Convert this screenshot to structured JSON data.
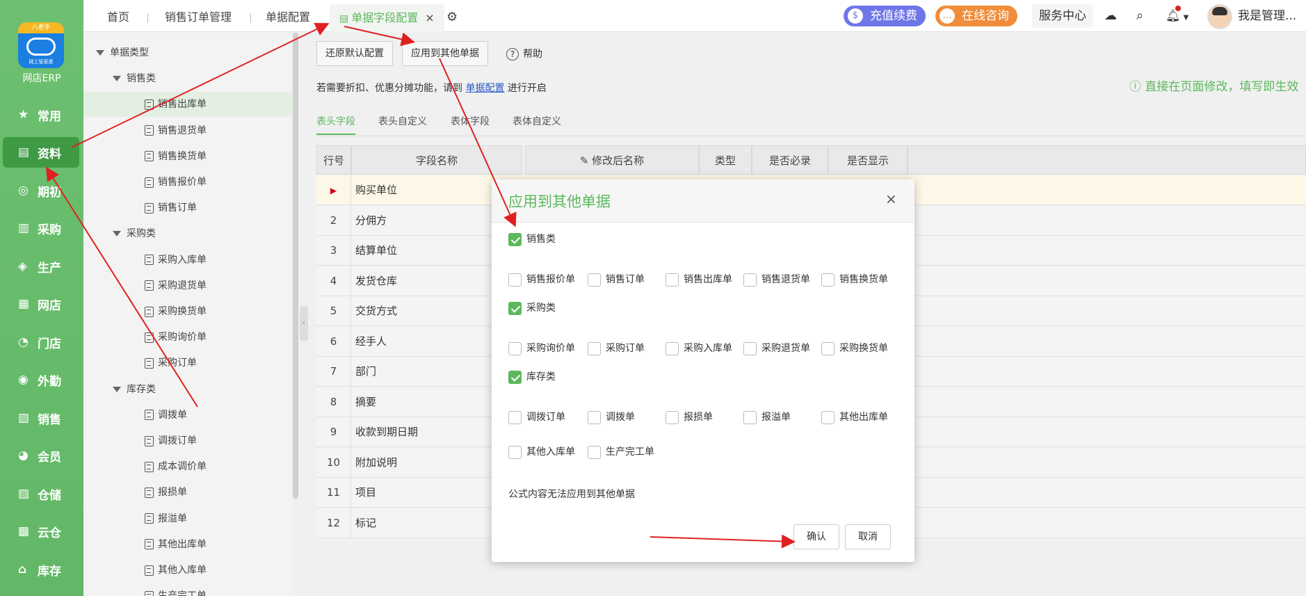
{
  "logo": {
    "band": "八老手",
    "sub": "网上管家婆",
    "name": "网店ERP"
  },
  "nav": [
    {
      "icon": "star-icon",
      "glyph": "★",
      "label": "常用"
    },
    {
      "icon": "document-icon",
      "glyph": "▤",
      "label": "资料"
    },
    {
      "icon": "target-icon",
      "glyph": "◎",
      "label": "期初"
    },
    {
      "icon": "purchase-icon",
      "glyph": "▥",
      "label": "采购"
    },
    {
      "icon": "production-icon",
      "glyph": "◈",
      "label": "生产"
    },
    {
      "icon": "shop-icon",
      "glyph": "▦",
      "label": "网店"
    },
    {
      "icon": "pie-icon",
      "glyph": "◔",
      "label": "门店"
    },
    {
      "icon": "field-icon",
      "glyph": "◉",
      "label": "外勤"
    },
    {
      "icon": "bar-chart-icon",
      "glyph": "▧",
      "label": "销售"
    },
    {
      "icon": "member-icon",
      "glyph": "◕",
      "label": "会员"
    },
    {
      "icon": "storage-icon",
      "glyph": "▨",
      "label": "仓储"
    },
    {
      "icon": "cloud-warehouse-icon",
      "glyph": "▩",
      "label": "云仓"
    },
    {
      "icon": "home-icon",
      "glyph": "⌂",
      "label": "库存"
    }
  ],
  "tabs": {
    "home": "首页",
    "sales_order_mgmt": "销售订单管理",
    "doc_config": "单据配置",
    "field_config": "单据字段配置",
    "close": "×",
    "settings": "⚙"
  },
  "top": {
    "recharge": "充值续费",
    "consult": "在线咨询",
    "service": "服务中心",
    "user": "我是管理..."
  },
  "tree": {
    "root": "单据类型",
    "groups": [
      {
        "label": "销售类",
        "items": [
          "销售出库单",
          "销售退货单",
          "销售换货单",
          "销售报价单",
          "销售订单"
        ]
      },
      {
        "label": "采购类",
        "items": [
          "采购入库单",
          "采购退货单",
          "采购换货单",
          "采购询价单",
          "采购订单"
        ]
      },
      {
        "label": "库存类",
        "items": [
          "调拨单",
          "调拨订单",
          "成本调价单",
          "报损单",
          "报溢单",
          "其他出库单",
          "其他入库单",
          "生产完工单"
        ]
      }
    ]
  },
  "toolbar": {
    "restore": "还原默认配置",
    "apply": "应用到其他单据",
    "help": "帮助"
  },
  "hint": {
    "pre": "若需要折扣、优惠分摊功能，请到",
    "link": "单据配置",
    "post": "进行开启"
  },
  "hint_right": "ⓘ 直接在页面修改，填写即生效",
  "subtabs": [
    "表头字段",
    "表头自定义",
    "表体字段",
    "表体自定义"
  ],
  "grid": {
    "headers": [
      "行号",
      "字段名称",
      "✎ 修改后名称",
      "类型",
      "是否必录",
      "是否显示"
    ],
    "rows": [
      "购买单位",
      "分佣方",
      "结算单位",
      "发货仓库",
      "交货方式",
      "经手人",
      "部门",
      "摘要",
      "收款到期日期",
      "附加说明",
      "项目",
      "标记"
    ]
  },
  "modal": {
    "title": "应用到其他单据",
    "close": "×",
    "groups": [
      {
        "label": "销售类",
        "checked": true,
        "items": [
          "销售报价单",
          "销售订单",
          "销售出库单",
          "销售退货单",
          "销售换货单"
        ]
      },
      {
        "label": "采购类",
        "checked": true,
        "items": [
          "采购询价单",
          "采购订单",
          "采购入库单",
          "采购退货单",
          "采购换货单"
        ]
      },
      {
        "label": "库存类",
        "checked": true,
        "items": [
          "调拨订单",
          "调拨单",
          "报损单",
          "报溢单",
          "其他出库单",
          "其他入库单",
          "生产完工单"
        ]
      }
    ],
    "note": "公式内容无法应用到其他单据",
    "confirm": "确认",
    "cancel": "取消"
  },
  "colors": {
    "accent": "#5cb85c",
    "annotation": "#e02020",
    "link": "#2a59c4"
  }
}
